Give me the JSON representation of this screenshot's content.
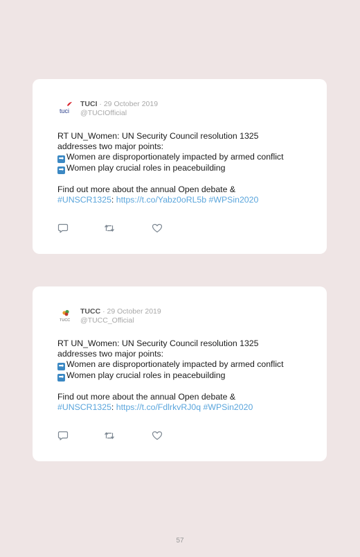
{
  "tweets": [
    {
      "author": {
        "name": "TUCI",
        "date": "29 October 2019",
        "handle": "@TUCIOfficial",
        "avatar_logo_text": "tuci"
      },
      "body": {
        "line1": "RT UN_Women: UN Security Council resolution 1325",
        "line2": "addresses two major points:",
        "point1": "Women are disproportionately impacted by armed conflict",
        "point2": "Women play crucial roles in peacebuilding",
        "line5": "Find out more about the annual Open debate &",
        "hashtag1": "#UNSCR1325",
        "colon": ":",
        "url": "https://t.co/Yabz0oRL5b",
        "hashtag2": "#WPSin2020"
      }
    },
    {
      "author": {
        "name": "TUCC",
        "date": "29 October 2019",
        "handle": "@TUCC_Official",
        "avatar_logo_text": "TUCC"
      },
      "body": {
        "line1": "RT UN_Women: UN Security Council resolution 1325",
        "line2": "addresses two major points:",
        "point1": "Women are disproportionately impacted by armed conflict",
        "point2": "Women play crucial roles in peacebuilding",
        "line5": "Find out more about the annual Open debate &",
        "hashtag1": "#UNSCR1325",
        "colon": ":",
        "url": "https://t.co/FdlrkvRJ0q",
        "hashtag2": "#WPSin2020"
      }
    }
  ],
  "icons": {
    "reply": "reply-icon",
    "retweet": "retweet-icon",
    "like": "heart-icon",
    "bullet": "right-arrow-icon"
  },
  "colors": {
    "page_background": "#efe5e5",
    "card_background": "#ffffff",
    "link": "#5aa5dc",
    "arrow_bullet": "#3b88c3"
  },
  "page": {
    "number": "57"
  }
}
